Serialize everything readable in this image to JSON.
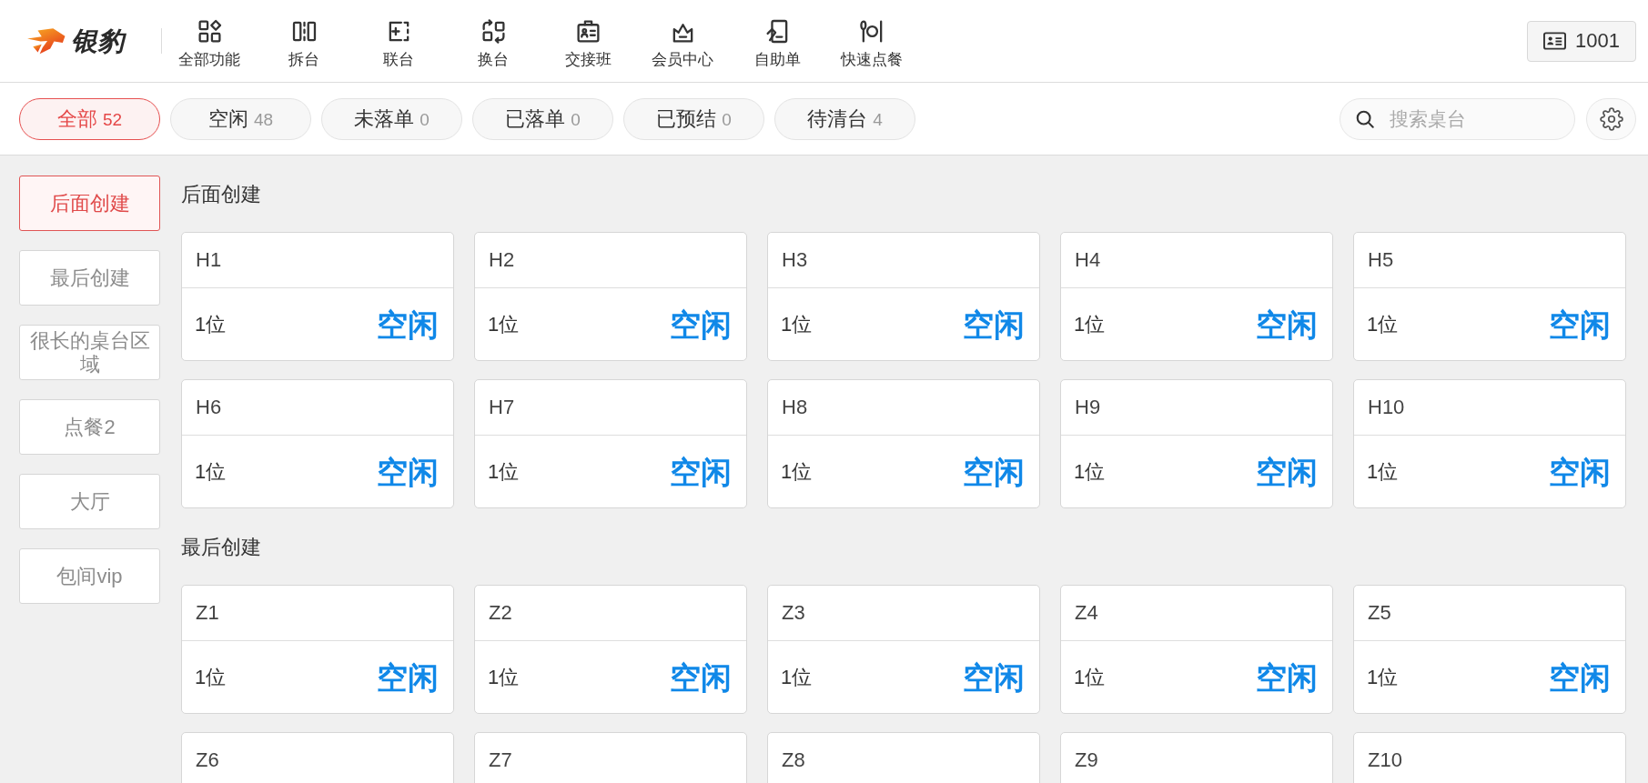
{
  "header": {
    "logo": {
      "text": "银豹"
    },
    "nav": [
      {
        "label": "全部功能"
      },
      {
        "label": "拆台"
      },
      {
        "label": "联台"
      },
      {
        "label": "换台"
      },
      {
        "label": "交接班"
      },
      {
        "label": "会员中心"
      },
      {
        "label": "自助单"
      },
      {
        "label": "快速点餐"
      }
    ],
    "user_button": {
      "label": "1001"
    }
  },
  "filters": {
    "chips": [
      {
        "label": "全部",
        "count": "52",
        "selected": true
      },
      {
        "label": "空闲",
        "count": "48",
        "selected": false
      },
      {
        "label": "未落单",
        "count": "0",
        "selected": false
      },
      {
        "label": "已落单",
        "count": "0",
        "selected": false
      },
      {
        "label": "已预结",
        "count": "0",
        "selected": false
      },
      {
        "label": "待清台",
        "count": "4",
        "selected": false
      }
    ],
    "search": {
      "placeholder": "搜索桌台"
    }
  },
  "sidebar": {
    "items": [
      {
        "label": "后面创建",
        "selected": true
      },
      {
        "label": "最后创建",
        "selected": false
      },
      {
        "label": "很长的桌台区域",
        "selected": false
      },
      {
        "label": "点餐2",
        "selected": false
      },
      {
        "label": "大厅",
        "selected": false
      },
      {
        "label": "包间vip",
        "selected": false
      }
    ]
  },
  "sections": [
    {
      "title": "后面创建",
      "tables": [
        {
          "name": "H1",
          "seats": "1位",
          "status": "空闲"
        },
        {
          "name": "H2",
          "seats": "1位",
          "status": "空闲"
        },
        {
          "name": "H3",
          "seats": "1位",
          "status": "空闲"
        },
        {
          "name": "H4",
          "seats": "1位",
          "status": "空闲"
        },
        {
          "name": "H5",
          "seats": "1位",
          "status": "空闲"
        },
        {
          "name": "H6",
          "seats": "1位",
          "status": "空闲"
        },
        {
          "name": "H7",
          "seats": "1位",
          "status": "空闲"
        },
        {
          "name": "H8",
          "seats": "1位",
          "status": "空闲"
        },
        {
          "name": "H9",
          "seats": "1位",
          "status": "空闲"
        },
        {
          "name": "H10",
          "seats": "1位",
          "status": "空闲"
        }
      ]
    },
    {
      "title": "最后创建",
      "tables": [
        {
          "name": "Z1",
          "seats": "1位",
          "status": "空闲"
        },
        {
          "name": "Z2",
          "seats": "1位",
          "status": "空闲"
        },
        {
          "name": "Z3",
          "seats": "1位",
          "status": "空闲"
        },
        {
          "name": "Z4",
          "seats": "1位",
          "status": "空闲"
        },
        {
          "name": "Z5",
          "seats": "1位",
          "status": "空闲"
        },
        {
          "name": "Z6"
        },
        {
          "name": "Z7"
        },
        {
          "name": "Z8"
        },
        {
          "name": "Z9"
        },
        {
          "name": "Z10"
        }
      ]
    }
  ]
}
